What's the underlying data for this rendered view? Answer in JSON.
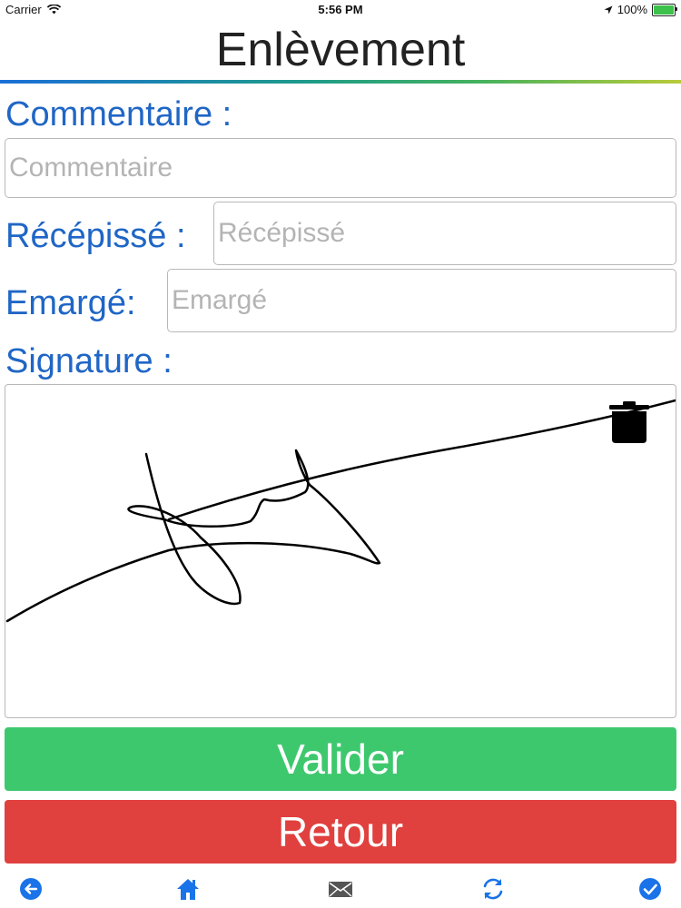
{
  "status_bar": {
    "carrier": "Carrier",
    "time": "5:56 PM",
    "battery": "100%"
  },
  "header": {
    "title": "Enlèvement"
  },
  "form": {
    "commentaire_label": "Commentaire :",
    "commentaire_placeholder": "Commentaire",
    "commentaire_value": "",
    "recepisse_label": "Récépissé :",
    "recepisse_placeholder": "Récépissé",
    "recepisse_value": "",
    "emarge_label": "Emargé:",
    "emarge_placeholder": "Emargé",
    "emarge_value": "",
    "signature_label": "Signature :"
  },
  "actions": {
    "validate_label": "Valider",
    "back_label": "Retour"
  },
  "toolbar": {
    "items": [
      "back-arrow-icon",
      "home-icon",
      "mail-icon",
      "sync-icon",
      "check-circle-icon"
    ]
  },
  "colors": {
    "accent_blue": "#1f66c6",
    "validate_green": "#3ec86e",
    "back_red": "#e0403e",
    "toolbar_blue": "#1a73e8"
  }
}
